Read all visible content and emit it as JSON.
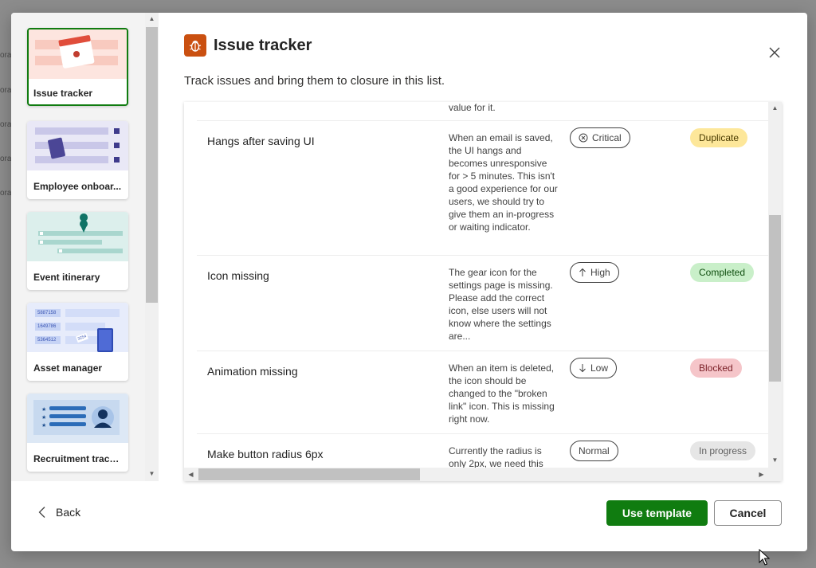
{
  "background": {
    "fragments": [
      "ora",
      "ora",
      "ora",
      "ora",
      "ora"
    ]
  },
  "templates": [
    {
      "label": "Issue tracker",
      "icon": "calendar-bug-icon",
      "selected": true
    },
    {
      "label": "Employee onboar...",
      "icon": "clipboard-checklist-icon",
      "selected": false
    },
    {
      "label": "Event itinerary",
      "icon": "map-pin-icon",
      "selected": false
    },
    {
      "label": "Asset manager",
      "icon": "device-tag-icon",
      "selected": false,
      "art_numbers": [
        "5887158",
        "1649786",
        "5364512",
        "3254"
      ]
    },
    {
      "label": "Recruitment tracker",
      "icon": "person-card-icon",
      "selected": false
    }
  ],
  "header": {
    "title": "Issue tracker",
    "icon": "bug-icon",
    "subtitle": "Track issues and bring them to closure in this list."
  },
  "preview": {
    "rows": [
      {
        "title": "",
        "description": "value for it.",
        "priority": "",
        "priority_icon": "",
        "status": ""
      },
      {
        "title": "Hangs after saving UI",
        "description": "When an email is saved, the UI hangs and becomes unresponsive for > 5 minutes. This isn't a good experience for our users, we should try to give them an in-progress or waiting indicator.",
        "priority": "Critical",
        "priority_icon": "x-circle-icon",
        "status": "Duplicate"
      },
      {
        "title": "Icon missing",
        "description": "The gear icon for the settings page is missing. Please add the correct icon, else users will not know where the settings are...",
        "priority": "High",
        "priority_icon": "arrow-up-icon",
        "status": "Completed"
      },
      {
        "title": "Animation missing",
        "description": "When an item is deleted, the icon should be changed to the \"broken link\" icon. This is missing right now.",
        "priority": "Low",
        "priority_icon": "arrow-down-icon",
        "status": "Blocked"
      },
      {
        "title": "Make button radius 6px",
        "description": "Currently the radius is only 2px, we need this",
        "priority": "Normal",
        "priority_icon": "",
        "status": "In progress"
      }
    ]
  },
  "footer": {
    "back_label": "Back",
    "primary_label": "Use template",
    "cancel_label": "Cancel"
  },
  "colors": {
    "accent": "#107c10",
    "title_icon_bg": "#ca5010",
    "status_duplicate": "#fde79a",
    "status_completed": "#c9efc9",
    "status_blocked": "#f5c5c9",
    "status_in_progress": "#e6e6e6"
  }
}
